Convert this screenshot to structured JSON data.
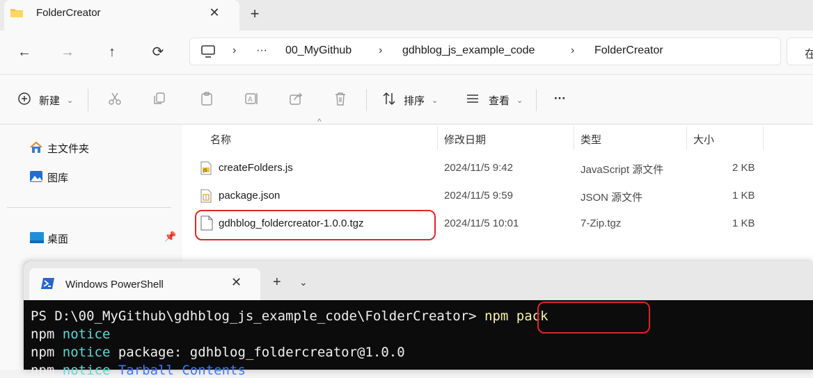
{
  "explorer": {
    "tab": {
      "title": "FolderCreator",
      "close_glyph": "✕",
      "new_glyph": "+"
    },
    "nav": {
      "back": "←",
      "forward": "→",
      "up": "↑",
      "refresh": "⟳"
    },
    "address": {
      "more": "···",
      "crumbs": [
        "00_MyGithub",
        "gdhblog_js_example_code",
        "FolderCreator"
      ],
      "separator": "›",
      "search_partial": "在"
    },
    "toolbar": {
      "new_label": "新建",
      "sort_label": "排序",
      "view_label": "查看",
      "more_label": "···"
    },
    "sidebar": {
      "items": [
        {
          "label": "主文件夹",
          "icon": "home-icon"
        },
        {
          "label": "图库",
          "icon": "gallery-icon"
        },
        {
          "label": "桌面",
          "icon": "desktop-icon"
        }
      ]
    },
    "columns": [
      "名称",
      "修改日期",
      "类型",
      "大小"
    ],
    "files": [
      {
        "name": "createFolders.js",
        "modified": "2024/11/5 9:42",
        "type": "JavaScript 源文件",
        "size": "2 KB",
        "icon": "js-file-icon"
      },
      {
        "name": "package.json",
        "modified": "2024/11/5 9:59",
        "type": "JSON 源文件",
        "size": "1 KB",
        "icon": "json-file-icon"
      },
      {
        "name": "gdhblog_foldercreator-1.0.0.tgz",
        "modified": "2024/11/5 10:01",
        "type": "7-Zip.tgz",
        "size": "1 KB",
        "icon": "archive-file-icon"
      }
    ]
  },
  "powershell": {
    "tab_title": "Windows PowerShell",
    "close_glyph": "✕",
    "new_glyph": "+",
    "dropdown_glyph": "⌄",
    "prompt": "PS D:\\00_MyGithub\\gdhblog_js_example_code\\FolderCreator> ",
    "command": "npm pack",
    "lines": [
      {
        "npm": "npm",
        "notice": "notice",
        "rest": ""
      },
      {
        "npm": "npm",
        "notice": "notice",
        "rest": " package: gdhblog_foldercreator@1.0.0"
      },
      {
        "npm": "npm",
        "notice": "notice",
        "rest": " Tarball Contents"
      }
    ]
  },
  "colors": {
    "highlight_border": "#e0242c",
    "terminal_bg": "#0c0c0c"
  }
}
